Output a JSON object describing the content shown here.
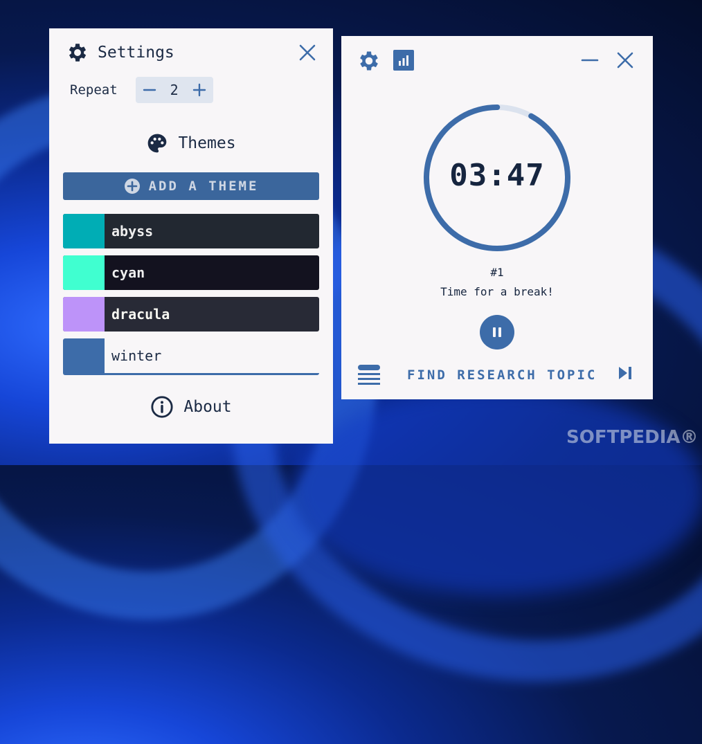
{
  "settings": {
    "title": "Settings",
    "repeat_label": "Repeat",
    "repeat_value": "2",
    "themes_title": "Themes",
    "add_theme_label": "ADD A THEME",
    "themes": [
      {
        "name": "abyss",
        "swatch": "#00adb5",
        "bg": "#222831",
        "fg": "#eeeeee"
      },
      {
        "name": "cyan",
        "swatch": "#40ffd0",
        "bg": "#13121f",
        "fg": "#eeeeee"
      },
      {
        "name": "dracula",
        "swatch": "#bd93f9",
        "bg": "#282a36",
        "fg": "#f8f8f2"
      },
      {
        "name": "winter",
        "swatch": "#3d6ca9",
        "bg": "#f8f6f8",
        "fg": "#1b2a44"
      }
    ],
    "about_title": "About"
  },
  "timer": {
    "time": "03:47",
    "round": "#1",
    "message": "Time for a break!",
    "progress": 0.92,
    "task": "FIND RESEARCH TOPIC"
  },
  "watermark": "SOFTPEDIA®",
  "colors": {
    "accent": "#3d6ca9",
    "ring_track": "#dbe2ee",
    "panel_bg": "#f8f6f8",
    "text": "#1b2a44"
  }
}
